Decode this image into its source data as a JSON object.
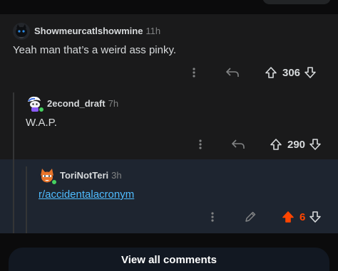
{
  "comments": [
    {
      "username": "Showmeurcatlshowmine",
      "time": "11h",
      "body": "Yeah man that’s a weird ass pinky.",
      "score": "306",
      "upvoted": false
    },
    {
      "username": "2econd_draft",
      "time": "7h",
      "body": "W.A.P.",
      "score": "290",
      "upvoted": false
    },
    {
      "username": "ToriNotTeri",
      "time": "3h",
      "body": "r/accidentalacronym",
      "score": "6",
      "upvoted": true
    }
  ],
  "footer": {
    "view_all_label": "View all comments"
  },
  "colors": {
    "upvote": "#ff4500",
    "link": "#4fbcff",
    "online": "#46d160"
  },
  "icons": [
    "more-icon",
    "reply-icon",
    "upvote-icon",
    "downvote-icon",
    "edit-icon"
  ]
}
